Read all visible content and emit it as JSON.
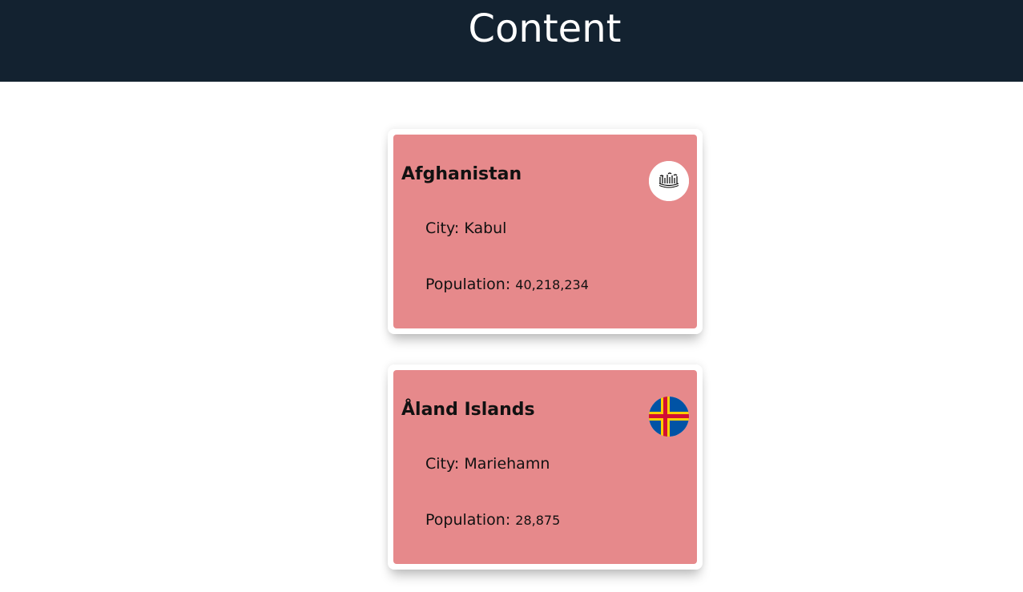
{
  "header": {
    "title": "Content"
  },
  "countries": [
    {
      "name": "Afghanistan",
      "city_label": "City:",
      "city": "Kabul",
      "population_label": "Population:",
      "population": "40,218,234",
      "flag_icon": "afghanistan-flag-icon",
      "flag_colors": [
        "#ffffff",
        "#000000"
      ]
    },
    {
      "name": "Åland Islands",
      "city_label": "City:",
      "city": "Mariehamn",
      "population_label": "Population:",
      "population": "28,875",
      "flag_icon": "aland-islands-flag-icon",
      "flag_colors": [
        "#0053a5",
        "#ffce00",
        "#d21034"
      ]
    }
  ],
  "colors": {
    "header_bg": "#132230",
    "card_bg": "#e6898b",
    "text": "#111111"
  }
}
